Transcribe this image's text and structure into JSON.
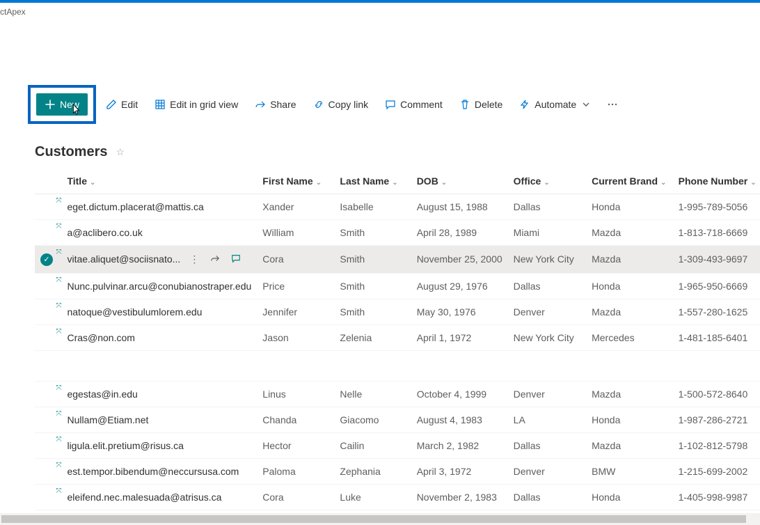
{
  "breadcrumb": "ctApex",
  "toolbar": {
    "new_label": "New",
    "edit_label": "Edit",
    "gridview_label": "Edit in grid view",
    "share_label": "Share",
    "copylink_label": "Copy link",
    "comment_label": "Comment",
    "delete_label": "Delete",
    "automate_label": "Automate"
  },
  "page_title": "Customers",
  "columns": {
    "title": "Title",
    "first_name": "First Name",
    "last_name": "Last Name",
    "dob": "DOB",
    "office": "Office",
    "brand": "Current Brand",
    "phone": "Phone Number"
  },
  "rows": [
    {
      "title": "eget.dictum.placerat@mattis.ca",
      "first": "Xander",
      "last": "Isabelle",
      "dob": "August 15, 1988",
      "office": "Dallas",
      "brand": "Honda",
      "phone": "1-995-789-5056"
    },
    {
      "title": "a@aclibero.co.uk",
      "first": "William",
      "last": "Smith",
      "dob": "April 28, 1989",
      "office": "Miami",
      "brand": "Mazda",
      "phone": "1-813-718-6669"
    },
    {
      "title": "vitae.aliquet@sociisnato...",
      "first": "Cora",
      "last": "Smith",
      "dob": "November 25, 2000",
      "office": "New York City",
      "brand": "Mazda",
      "phone": "1-309-493-9697",
      "selected": true
    },
    {
      "title": "Nunc.pulvinar.arcu@conubianostraper.edu",
      "first": "Price",
      "last": "Smith",
      "dob": "August 29, 1976",
      "office": "Dallas",
      "brand": "Honda",
      "phone": "1-965-950-6669"
    },
    {
      "title": "natoque@vestibulumlorem.edu",
      "first": "Jennifer",
      "last": "Smith",
      "dob": "May 30, 1976",
      "office": "Denver",
      "brand": "Mazda",
      "phone": "1-557-280-1625"
    },
    {
      "title": "Cras@non.com",
      "first": "Jason",
      "last": "Zelenia",
      "dob": "April 1, 1972",
      "office": "New York City",
      "brand": "Mercedes",
      "phone": "1-481-185-6401"
    },
    {
      "title": "egestas@in.edu",
      "first": "Linus",
      "last": "Nelle",
      "dob": "October 4, 1999",
      "office": "Denver",
      "brand": "Mazda",
      "phone": "1-500-572-8640"
    },
    {
      "title": "Nullam@Etiam.net",
      "first": "Chanda",
      "last": "Giacomo",
      "dob": "August 4, 1983",
      "office": "LA",
      "brand": "Honda",
      "phone": "1-987-286-2721"
    },
    {
      "title": "ligula.elit.pretium@risus.ca",
      "first": "Hector",
      "last": "Cailin",
      "dob": "March 2, 1982",
      "office": "Dallas",
      "brand": "Mazda",
      "phone": "1-102-812-5798"
    },
    {
      "title": "est.tempor.bibendum@neccursusa.com",
      "first": "Paloma",
      "last": "Zephania",
      "dob": "April 3, 1972",
      "office": "Denver",
      "brand": "BMW",
      "phone": "1-215-699-2002"
    },
    {
      "title": "eleifend.nec.malesuada@atrisus.ca",
      "first": "Cora",
      "last": "Luke",
      "dob": "November 2, 1983",
      "office": "Dallas",
      "brand": "Honda",
      "phone": "1-405-998-9987"
    }
  ]
}
